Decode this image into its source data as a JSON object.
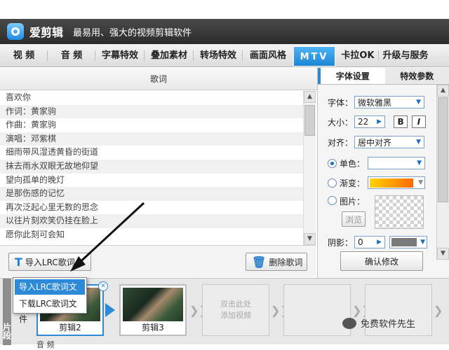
{
  "app": {
    "name": "爱剪辑",
    "slogan": "最易用、强大的视频剪辑软件"
  },
  "tabs": [
    {
      "label": "视 频"
    },
    {
      "label": "音 频"
    },
    {
      "label": "字幕特效"
    },
    {
      "label": "叠加素材"
    },
    {
      "label": "转场特效"
    },
    {
      "label": "画面风格"
    },
    {
      "label": "MTV",
      "active": true
    },
    {
      "label": "卡拉OK"
    },
    {
      "label": "升级与服务"
    }
  ],
  "lyrics": {
    "header": "歌词",
    "rows": [
      "喜欢你",
      "作词：黄家驹",
      "作曲：黄家驹",
      "演唱：邓紫棋",
      "细雨带风湿透黄昏的街道",
      "抹去雨水双眼无故地仰望",
      "望向孤单的晚灯",
      "是那伤感的记忆",
      "再次泛起心里无数的思念",
      "以往片刻欢笑仍挂在脸上",
      "愿你此刻可会知"
    ],
    "import_button": "导入LRC歌词",
    "delete_button": "删除歌词"
  },
  "right_panel": {
    "tabs": [
      {
        "label": "字体设置",
        "active": true
      },
      {
        "label": "特效参数"
      }
    ],
    "font_label": "字体：",
    "font_value": "微软雅黑",
    "size_label": "大小：",
    "size_value": "22",
    "bold": "B",
    "italic": "I",
    "align_label": "对齐：",
    "align_value": "居中对齐",
    "single_color_label": "单色：",
    "gradient_label": "渐变：",
    "image_label": "图片：",
    "browse_button": "浏览",
    "shadow_label": "阴影：",
    "shadow_value": "0",
    "confirm_button": "确认修改",
    "gradient_colors": [
      "#ffd400",
      "#ff6a00"
    ]
  },
  "popup": {
    "items": [
      "导入LRC歌词文件",
      "下载LRC歌词文件"
    ]
  },
  "timeline": {
    "side_label": "片段",
    "clips": [
      "剪辑2",
      "剪辑3"
    ],
    "add_placeholder": [
      "双击此处",
      "添加视频"
    ],
    "bottom_text": "音 频"
  },
  "watermark": "免费软件先生"
}
